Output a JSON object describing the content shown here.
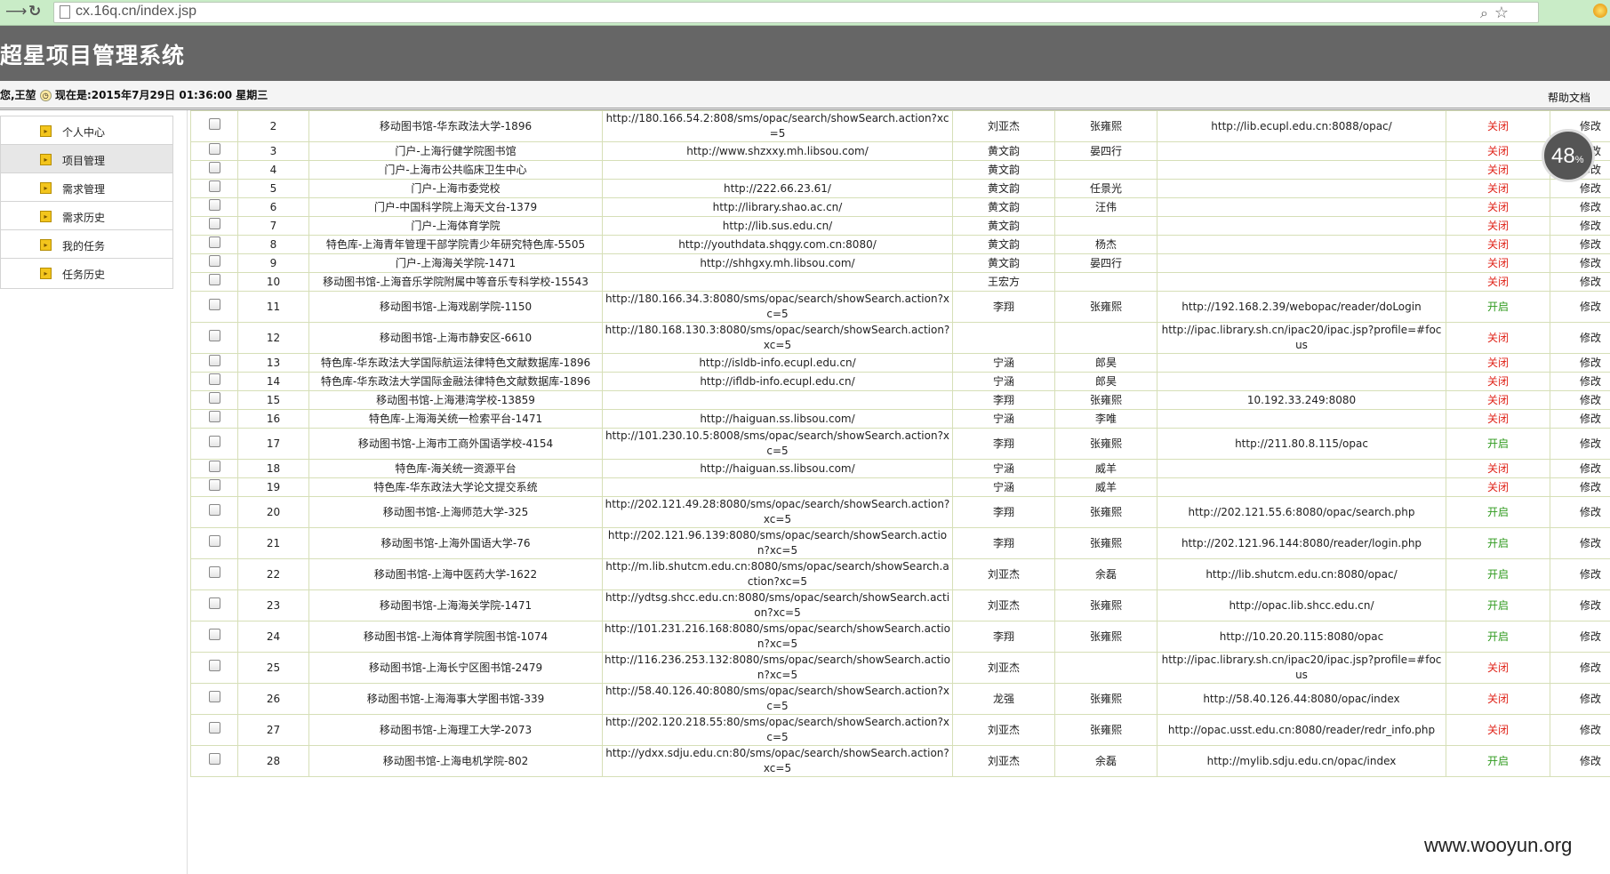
{
  "browser": {
    "url": "cx.16q.cn/index.jsp"
  },
  "app": {
    "title": "超星项目管理系统",
    "user_info": "您,王堃",
    "time_text": "现在是:2015年7月29日 01:36:00 星期三",
    "help": "帮助文档"
  },
  "sidebar": {
    "items": [
      {
        "label": "个人中心"
      },
      {
        "label": "项目管理"
      },
      {
        "label": "需求管理"
      },
      {
        "label": "需求历史"
      },
      {
        "label": "我的任务"
      },
      {
        "label": "任务历史"
      }
    ]
  },
  "table": {
    "rows": [
      {
        "no": "2",
        "name": "移动图书馆-华东政法大学-1896",
        "url": "http://180.166.54.2:808/sms/opac/search/showSearch.action?xc=5",
        "a": "刘亚杰",
        "b": "张雍熙",
        "opac": "http://lib.ecupl.edu.cn:8088/opac/",
        "status": "关闭",
        "open": false,
        "edit": "修改"
      },
      {
        "no": "3",
        "name": "门户-上海行健学院图书馆",
        "url": "http://www.shzxxy.mh.libsou.com/",
        "a": "黄文韵",
        "b": "晏四行",
        "opac": "",
        "status": "关闭",
        "open": false,
        "edit": "修改"
      },
      {
        "no": "4",
        "name": "门户-上海市公共临床卫生中心",
        "url": "",
        "a": "黄文韵",
        "b": "",
        "opac": "",
        "status": "关闭",
        "open": false,
        "edit": "修改"
      },
      {
        "no": "5",
        "name": "门户-上海市委党校",
        "url": "http://222.66.23.61/",
        "a": "黄文韵",
        "b": "任景光",
        "opac": "",
        "status": "关闭",
        "open": false,
        "edit": "修改"
      },
      {
        "no": "6",
        "name": "门户-中国科学院上海天文台-1379",
        "url": "http://library.shao.ac.cn/",
        "a": "黄文韵",
        "b": "汪伟",
        "opac": "",
        "status": "关闭",
        "open": false,
        "edit": "修改"
      },
      {
        "no": "7",
        "name": "门户-上海体育学院",
        "url": "http://lib.sus.edu.cn/",
        "a": "黄文韵",
        "b": "",
        "opac": "",
        "status": "关闭",
        "open": false,
        "edit": "修改"
      },
      {
        "no": "8",
        "name": "特色库-上海青年管理干部学院青少年研究特色库-5505",
        "url": "http://youthdata.shqgy.com.cn:8080/",
        "a": "黄文韵",
        "b": "杨杰",
        "opac": "",
        "status": "关闭",
        "open": false,
        "edit": "修改"
      },
      {
        "no": "9",
        "name": "门户-上海海关学院-1471",
        "url": "http://shhgxy.mh.libsou.com/",
        "a": "黄文韵",
        "b": "晏四行",
        "opac": "",
        "status": "关闭",
        "open": false,
        "edit": "修改"
      },
      {
        "no": "10",
        "name": "移动图书馆-上海音乐学院附属中等音乐专科学校-15543",
        "url": "",
        "a": "王宏方",
        "b": "",
        "opac": "",
        "status": "关闭",
        "open": false,
        "edit": "修改"
      },
      {
        "no": "11",
        "name": "移动图书馆-上海戏剧学院-1150",
        "url": "http://180.166.34.3:8080/sms/opac/search/showSearch.action?xc=5",
        "a": "李翔",
        "b": "张雍熙",
        "opac": "http://192.168.2.39/webopac/reader/doLogin",
        "status": "开启",
        "open": true,
        "edit": "修改"
      },
      {
        "no": "12",
        "name": "移动图书馆-上海市静安区-6610",
        "url": "http://180.168.130.3:8080/sms/opac/search/showSearch.action?xc=5",
        "a": "",
        "b": "",
        "opac": "http://ipac.library.sh.cn/ipac20/ipac.jsp?profile=#focus",
        "status": "关闭",
        "open": false,
        "edit": "修改"
      },
      {
        "no": "13",
        "name": "特色库-华东政法大学国际航运法律特色文献数据库-1896",
        "url": "http://isldb-info.ecupl.edu.cn/",
        "a": "宁涵",
        "b": "郎昊",
        "opac": "",
        "status": "关闭",
        "open": false,
        "edit": "修改"
      },
      {
        "no": "14",
        "name": "特色库-华东政法大学国际金融法律特色文献数据库-1896",
        "url": "http://ifldb-info.ecupl.edu.cn/",
        "a": "宁涵",
        "b": "郎昊",
        "opac": "",
        "status": "关闭",
        "open": false,
        "edit": "修改"
      },
      {
        "no": "15",
        "name": "移动图书馆-上海港湾学校-13859",
        "url": "",
        "a": "李翔",
        "b": "张雍熙",
        "opac": "10.192.33.249:8080",
        "status": "关闭",
        "open": false,
        "edit": "修改"
      },
      {
        "no": "16",
        "name": "特色库-上海海关统一检索平台-1471",
        "url": "http://haiguan.ss.libsou.com/",
        "a": "宁涵",
        "b": "李唯",
        "opac": "",
        "status": "关闭",
        "open": false,
        "edit": "修改"
      },
      {
        "no": "17",
        "name": "移动图书馆-上海市工商外国语学校-4154",
        "url": "http://101.230.10.5:8008/sms/opac/search/showSearch.action?xc=5",
        "a": "李翔",
        "b": "张雍熙",
        "opac": "http://211.80.8.115/opac",
        "status": "开启",
        "open": true,
        "edit": "修改"
      },
      {
        "no": "18",
        "name": "特色库-海关统一资源平台",
        "url": "http://haiguan.ss.libsou.com/",
        "a": "宁涵",
        "b": "威羊",
        "opac": "",
        "status": "关闭",
        "open": false,
        "edit": "修改"
      },
      {
        "no": "19",
        "name": "特色库-华东政法大学论文提交系统",
        "url": "",
        "a": "宁涵",
        "b": "威羊",
        "opac": "",
        "status": "关闭",
        "open": false,
        "edit": "修改"
      },
      {
        "no": "20",
        "name": "移动图书馆-上海师范大学-325",
        "url": "http://202.121.49.28:8080/sms/opac/search/showSearch.action?xc=5",
        "a": "李翔",
        "b": "张雍熙",
        "opac": "http://202.121.55.6:8080/opac/search.php",
        "status": "开启",
        "open": true,
        "edit": "修改"
      },
      {
        "no": "21",
        "name": "移动图书馆-上海外国语大学-76",
        "url": "http://202.121.96.139:8080/sms/opac/search/showSearch.action?xc=5",
        "a": "李翔",
        "b": "张雍熙",
        "opac": "http://202.121.96.144:8080/reader/login.php",
        "status": "开启",
        "open": true,
        "edit": "修改"
      },
      {
        "no": "22",
        "name": "移动图书馆-上海中医药大学-1622",
        "url": "http://m.lib.shutcm.edu.cn:8080/sms/opac/search/showSearch.action?xc=5",
        "a": "刘亚杰",
        "b": "余磊",
        "opac": "http://lib.shutcm.edu.cn:8080/opac/",
        "status": "开启",
        "open": true,
        "edit": "修改"
      },
      {
        "no": "23",
        "name": "移动图书馆-上海海关学院-1471",
        "url": "http://ydtsg.shcc.edu.cn:8080/sms/opac/search/showSearch.action?xc=5",
        "a": "刘亚杰",
        "b": "张雍熙",
        "opac": "http://opac.lib.shcc.edu.cn/",
        "status": "开启",
        "open": true,
        "edit": "修改"
      },
      {
        "no": "24",
        "name": "移动图书馆-上海体育学院图书馆-1074",
        "url": "http://101.231.216.168:8080/sms/opac/search/showSearch.action?xc=5",
        "a": "李翔",
        "b": "张雍熙",
        "opac": "http://10.20.20.115:8080/opac",
        "status": "开启",
        "open": true,
        "edit": "修改"
      },
      {
        "no": "25",
        "name": "移动图书馆-上海长宁区图书馆-2479",
        "url": "http://116.236.253.132:8080/sms/opac/search/showSearch.action?xc=5",
        "a": "刘亚杰",
        "b": "",
        "opac": "http://ipac.library.sh.cn/ipac20/ipac.jsp?profile=#focus",
        "status": "关闭",
        "open": false,
        "edit": "修改"
      },
      {
        "no": "26",
        "name": "移动图书馆-上海海事大学图书馆-339",
        "url": "http://58.40.126.40:8080/sms/opac/search/showSearch.action?xc=5",
        "a": "龙强",
        "b": "张雍熙",
        "opac": "http://58.40.126.44:8080/opac/index",
        "status": "关闭",
        "open": false,
        "edit": "修改"
      },
      {
        "no": "27",
        "name": "移动图书馆-上海理工大学-2073",
        "url": "http://202.120.218.55:80/sms/opac/search/showSearch.action?xc=5",
        "a": "刘亚杰",
        "b": "张雍熙",
        "opac": "http://opac.usst.edu.cn:8080/reader/redr_info.php",
        "status": "关闭",
        "open": false,
        "edit": "修改"
      },
      {
        "no": "28",
        "name": "移动图书馆-上海电机学院-802",
        "url": "http://ydxx.sdju.edu.cn:80/sms/opac/search/showSearch.action?xc=5",
        "a": "刘亚杰",
        "b": "余磊",
        "opac": "http://mylib.sdju.edu.cn/opac/index",
        "status": "开启",
        "open": true,
        "edit": "修改"
      }
    ]
  },
  "overlay": {
    "progress_value": "48",
    "progress_unit": "%",
    "watermark": "www.wooyun.org"
  }
}
